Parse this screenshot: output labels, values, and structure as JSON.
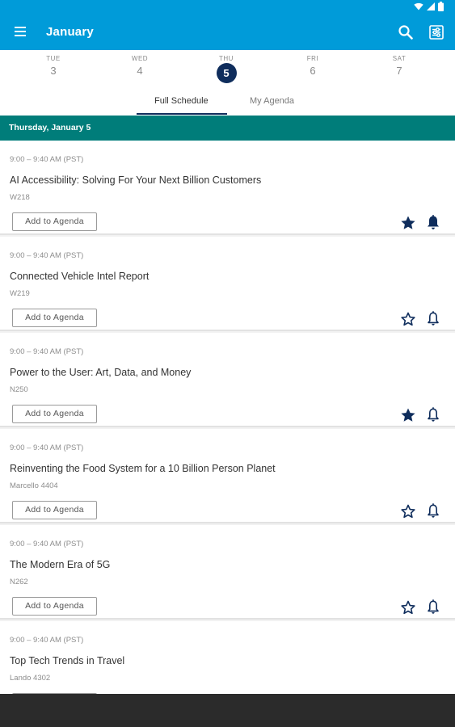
{
  "app": {
    "title": "January"
  },
  "days": [
    {
      "name": "TUE",
      "num": "3",
      "selected": false
    },
    {
      "name": "WED",
      "num": "4",
      "selected": false
    },
    {
      "name": "THU",
      "num": "5",
      "selected": true
    },
    {
      "name": "FRI",
      "num": "6",
      "selected": false
    },
    {
      "name": "SAT",
      "num": "7",
      "selected": false
    }
  ],
  "tabs": [
    {
      "label": "Full Schedule",
      "active": true
    },
    {
      "label": "My Agenda",
      "active": false
    }
  ],
  "date_header": "Thursday, January 5",
  "add_label": "Add to Agenda",
  "colors": {
    "appbar": "#009bd9",
    "navy": "#0f2d5c",
    "teal": "#007d7a"
  },
  "sessions": [
    {
      "time": "9:00 – 9:40 AM (PST)",
      "title": "AI Accessibility: Solving For Your Next Billion Customers",
      "room": "W218",
      "starred": true,
      "bell_filled": true
    },
    {
      "time": "9:00 – 9:40 AM (PST)",
      "title": "Connected Vehicle Intel Report",
      "room": "W219",
      "starred": false,
      "bell_filled": false
    },
    {
      "time": "9:00 – 9:40 AM (PST)",
      "title": "Power to the User: Art, Data, and Money",
      "room": "N250",
      "starred": true,
      "bell_filled": false
    },
    {
      "time": "9:00 – 9:40 AM (PST)",
      "title": "Reinventing the Food System for a 10 Billion Person Planet",
      "room": "Marcello 4404",
      "starred": false,
      "bell_filled": false
    },
    {
      "time": "9:00 – 9:40 AM (PST)",
      "title": "The Modern Era of 5G",
      "room": "N262",
      "starred": false,
      "bell_filled": false
    },
    {
      "time": "9:00 – 9:40 AM (PST)",
      "title": "Top Tech Trends in Travel",
      "room": "Lando 4302",
      "starred": false,
      "bell_filled": false
    }
  ]
}
